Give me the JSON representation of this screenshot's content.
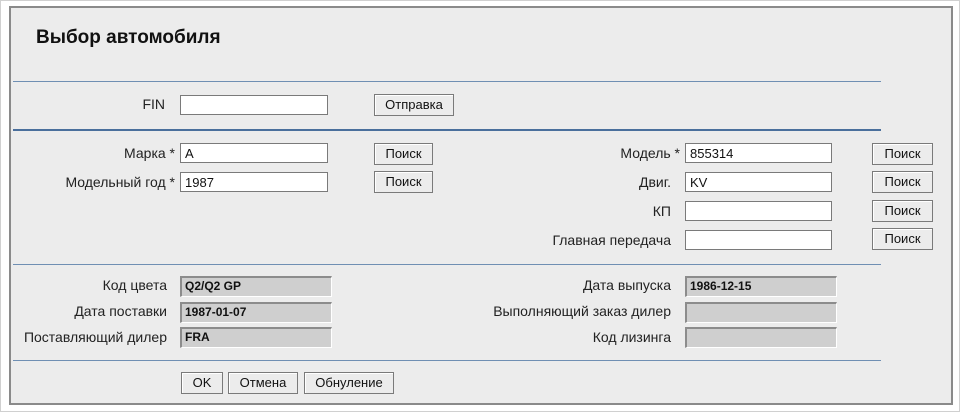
{
  "page": {
    "title": "Выбор автомобиля"
  },
  "fin": {
    "label": "FIN",
    "value": "",
    "submit_label": "Отправка"
  },
  "vehicle": {
    "make": {
      "label": "Марка *",
      "value": "A",
      "search_label": "Поиск"
    },
    "model_year": {
      "label": "Модельный год *",
      "value": "1987",
      "search_label": "Поиск"
    },
    "model": {
      "label": "Модель *",
      "value": "855314",
      "search_label": "Поиск"
    },
    "engine": {
      "label": "Двиг.",
      "value": "KV",
      "search_label": "Поиск"
    },
    "transmission": {
      "label": "КП",
      "value": "",
      "search_label": "Поиск"
    },
    "final_drive": {
      "label": "Главная передача",
      "value": "",
      "search_label": "Поиск"
    }
  },
  "details": {
    "color_code": {
      "label": "Код цвета",
      "value": "Q2/Q2 GP"
    },
    "delivery_date": {
      "label": "Дата поставки",
      "value": "1987-01-07"
    },
    "supplying_dealer": {
      "label": "Поставляющий дилер",
      "value": "FRA"
    },
    "release_date": {
      "label": "Дата выпуска",
      "value": "1986-12-15"
    },
    "ordering_dealer": {
      "label": "Выполняющий заказ дилер",
      "value": ""
    },
    "leasing_code": {
      "label": "Код лизинга",
      "value": ""
    }
  },
  "actions": {
    "ok_label": "OK",
    "cancel_label": "Отмена",
    "reset_label": "Обнуление"
  }
}
